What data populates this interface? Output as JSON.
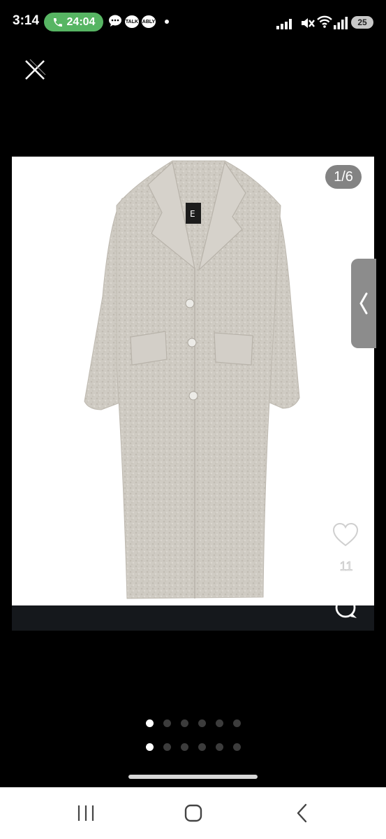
{
  "status_bar": {
    "time": "3:14",
    "call_timer": "24:04",
    "notifications": [
      "TALK",
      "ABLY"
    ],
    "battery": "25"
  },
  "viewer": {
    "counter": "1/6",
    "like_count": "11",
    "pagination": {
      "top_row": {
        "total": 6,
        "active_index": 0
      },
      "bottom_row": {
        "total": 6,
        "active_index": 0
      }
    }
  },
  "colors": {
    "call_pill": "#57b563",
    "coat": "#cfcbc3",
    "background": "#000000",
    "image_background": "#ffffff"
  },
  "icons": [
    "close-icon",
    "phone-icon",
    "chat-bubble-icon",
    "heart-icon",
    "comment-icon",
    "chevron-left-icon",
    "recents-icon",
    "home-icon",
    "back-icon"
  ]
}
